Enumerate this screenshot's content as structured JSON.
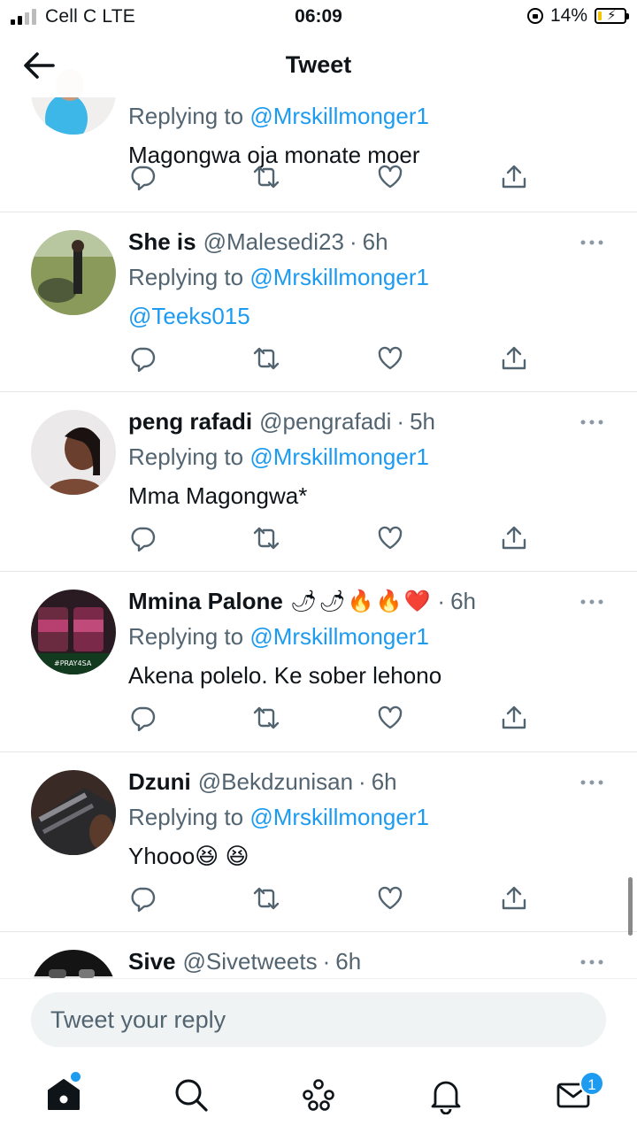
{
  "status_bar": {
    "carrier": "Cell C  LTE",
    "time": "06:09",
    "battery": "14%",
    "battery_level": 0.14
  },
  "header": {
    "title": "Tweet"
  },
  "tweets": [
    {
      "name": "",
      "handle": "",
      "time": "",
      "replying_label": "Replying to",
      "replying_to": "@Mrskillmonger1",
      "text": "Magongwa oja monate moer"
    },
    {
      "name": "She is",
      "handle": "@Malesedi23",
      "time": "6h",
      "replying_label": "Replying to",
      "replying_to": "@Mrskillmonger1",
      "text": "@Teeks015"
    },
    {
      "name": "peng rafadi",
      "handle": "@pengrafadi",
      "time": "5h",
      "replying_label": "Replying to",
      "replying_to": "@Mrskillmonger1",
      "text": "Mma Magongwa*"
    },
    {
      "name": "Mmina Palone",
      "name_emoji": "🌶🌶🔥🔥❤️",
      "handle": "",
      "time": "6h",
      "replying_label": "Replying to",
      "replying_to": "@Mrskillmonger1",
      "text": "Akena polelo. Ke sober lehono"
    },
    {
      "name": "Dzuni",
      "handle": "@Bekdzunisan",
      "time": "6h",
      "replying_label": "Replying to",
      "replying_to": "@Mrskillmonger1",
      "text": "Yhooo😆 😆"
    },
    {
      "name": "Sive",
      "handle": "@Sivetweets",
      "time": "6h"
    }
  ],
  "avatar_texts": {
    "mmina_avatar_caption": "#PRAY4SA"
  },
  "reply_bar": {
    "placeholder": "Tweet your reply"
  },
  "tab_bar": {
    "items": [
      "home-icon",
      "search-icon",
      "spaces-icon",
      "notifications-icon",
      "messages-icon"
    ],
    "messages_badge": "1"
  },
  "colors": {
    "accent": "#1d9bf0",
    "text": "#0f1419",
    "secondary": "#536471",
    "divider": "#e3e7ea"
  }
}
